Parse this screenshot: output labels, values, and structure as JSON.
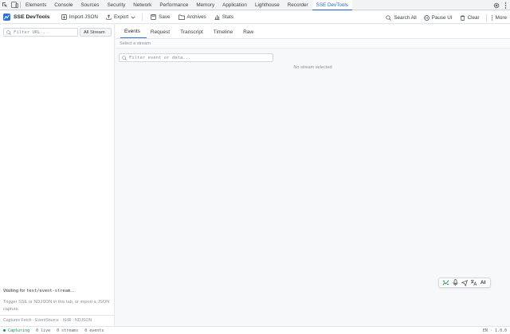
{
  "devtools": {
    "tabs": [
      "Elements",
      "Console",
      "Sources",
      "Security",
      "Network",
      "Performance",
      "Memory",
      "Application",
      "Lighthouse",
      "Recorder",
      "SSE DevTools"
    ],
    "active_tab": "SSE DevTools"
  },
  "header": {
    "brand": "SSE DevTools",
    "import_label": "Import JSON",
    "export_label": "Export",
    "save_label": "Save",
    "archives_label": "Archives",
    "stats_label": "Stats",
    "search_all_label": "Search All",
    "pause_label": "Pause UI",
    "clear_label": "Clear",
    "more_label": "More"
  },
  "sidebar": {
    "filter_placeholder": "Filter URL...",
    "stream_select": "All Stream",
    "waiting_prefix": "Waiting for ",
    "waiting_code": "text/event-stream",
    "waiting_suffix": "...",
    "hint": "Trigger SSE or NDJSON in this tab, or import a JSON capture.",
    "footer": "Captures Fetch · EventSource · XHR · NDJSON"
  },
  "main": {
    "tabs": [
      "Events",
      "Request",
      "Transcript",
      "Timeline",
      "Raw"
    ],
    "active_tab": "Events",
    "subheader": "Select a stream",
    "event_filter_placeholder": "Filter event or data...",
    "empty": "No stream selected"
  },
  "floating_toolbar": {
    "ai_label": "AI"
  },
  "status": {
    "capturing": "Capturing",
    "live": "0 live",
    "streams": "0 streams",
    "events": "0 events",
    "version": "EN · 1.0.0"
  },
  "colors": {
    "accent": "#2f6fd8",
    "devtools_active": "#1a66d8",
    "live": "#1a8a4a"
  }
}
